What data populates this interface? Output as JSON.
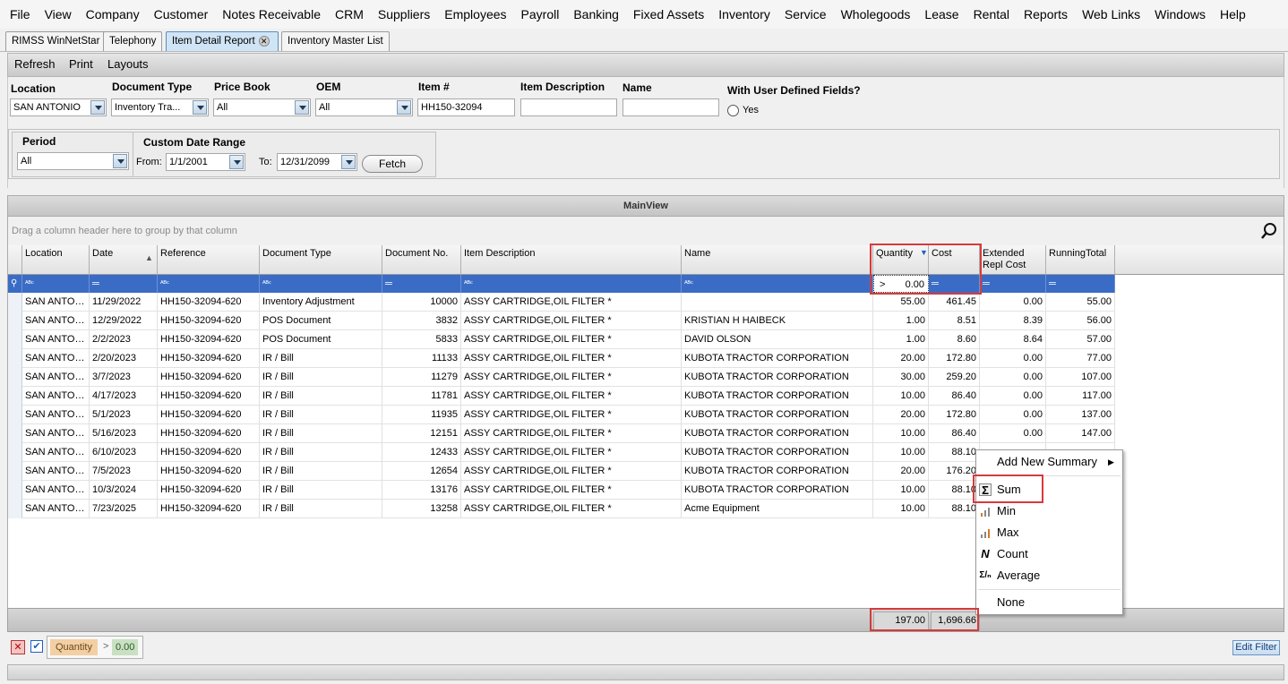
{
  "menu": [
    "File",
    "View",
    "Company",
    "Customer",
    "Notes Receivable",
    "CRM",
    "Suppliers",
    "Employees",
    "Payroll",
    "Banking",
    "Fixed Assets",
    "Inventory",
    "Service",
    "Wholegoods",
    "Lease",
    "Rental",
    "Reports",
    "Web Links",
    "Windows",
    "Help"
  ],
  "tabs": [
    "RIMSS WinNetStar",
    "Telephony",
    "Item Detail Report",
    "Inventory Master List"
  ],
  "toolbar": {
    "refresh": "Refresh",
    "print": "Print",
    "layouts": "Layouts"
  },
  "filters": {
    "location_label": "Location",
    "location_value": "SAN ANTONIO",
    "doctype_label": "Document Type",
    "doctype_value": "Inventory Tra...",
    "pricebook_label": "Price Book",
    "pricebook_value": "All",
    "oem_label": "OEM",
    "oem_value": "All",
    "item_label": "Item #",
    "item_value": "HH150-32094",
    "desc_label": "Item Description",
    "desc_value": "",
    "name_label": "Name",
    "name_value": "",
    "udf_label": "With User Defined Fields?",
    "udf_yes": "Yes"
  },
  "period": {
    "label": "Period",
    "value": "All"
  },
  "daterange": {
    "label": "Custom Date Range",
    "from_label": "From:",
    "from_value": "1/1/2001",
    "to_label": "To:",
    "to_value": "12/31/2099",
    "fetch": "Fetch"
  },
  "grid": {
    "title": "MainView",
    "group_hint": "Drag a column header here to group by that column",
    "columns": [
      "Location",
      "Date",
      "Reference",
      "Document Type",
      "Document No.",
      "Item Description",
      "Name",
      "Quantity",
      "Cost",
      "Extended Repl Cost",
      "RunningTotal"
    ],
    "filter_quantity": "0.00",
    "rows": [
      [
        "SAN ANTON...",
        "11/29/2022",
        "HH150-32094-620",
        "Inventory Adjustment",
        "10000",
        "ASSY CARTRIDGE,OIL FILTER   *",
        "",
        "55.00",
        "461.45",
        "0.00",
        "55.00"
      ],
      [
        "SAN ANTON...",
        "12/29/2022",
        "HH150-32094-620",
        "POS Document",
        "3832",
        "ASSY CARTRIDGE,OIL FILTER   *",
        "KRISTIAN H HAIBECK",
        "1.00",
        "8.51",
        "8.39",
        "56.00"
      ],
      [
        "SAN ANTON...",
        "2/2/2023",
        "HH150-32094-620",
        "POS Document",
        "5833",
        "ASSY CARTRIDGE,OIL FILTER   *",
        "DAVID OLSON",
        "1.00",
        "8.60",
        "8.64",
        "57.00"
      ],
      [
        "SAN ANTON...",
        "2/20/2023",
        "HH150-32094-620",
        "IR / Bill",
        "11133",
        "ASSY CARTRIDGE,OIL FILTER   *",
        "KUBOTA TRACTOR CORPORATION",
        "20.00",
        "172.80",
        "0.00",
        "77.00"
      ],
      [
        "SAN ANTON...",
        "3/7/2023",
        "HH150-32094-620",
        "IR / Bill",
        "11279",
        "ASSY CARTRIDGE,OIL FILTER   *",
        "KUBOTA TRACTOR CORPORATION",
        "30.00",
        "259.20",
        "0.00",
        "107.00"
      ],
      [
        "SAN ANTON...",
        "4/17/2023",
        "HH150-32094-620",
        "IR / Bill",
        "11781",
        "ASSY CARTRIDGE,OIL FILTER   *",
        "KUBOTA TRACTOR CORPORATION",
        "10.00",
        "86.40",
        "0.00",
        "117.00"
      ],
      [
        "SAN ANTON...",
        "5/1/2023",
        "HH150-32094-620",
        "IR / Bill",
        "11935",
        "ASSY CARTRIDGE,OIL FILTER   *",
        "KUBOTA TRACTOR CORPORATION",
        "20.00",
        "172.80",
        "0.00",
        "137.00"
      ],
      [
        "SAN ANTON...",
        "5/16/2023",
        "HH150-32094-620",
        "IR / Bill",
        "12151",
        "ASSY CARTRIDGE,OIL FILTER   *",
        "KUBOTA TRACTOR CORPORATION",
        "10.00",
        "86.40",
        "0.00",
        "147.00"
      ],
      [
        "SAN ANTON...",
        "6/10/2023",
        "HH150-32094-620",
        "IR / Bill",
        "12433",
        "ASSY CARTRIDGE,OIL FILTER   *",
        "KUBOTA TRACTOR CORPORATION",
        "10.00",
        "88.10",
        "",
        ""
      ],
      [
        "SAN ANTON...",
        "7/5/2023",
        "HH150-32094-620",
        "IR / Bill",
        "12654",
        "ASSY CARTRIDGE,OIL FILTER   *",
        "KUBOTA TRACTOR CORPORATION",
        "20.00",
        "176.20",
        "",
        ""
      ],
      [
        "SAN ANTON...",
        "10/3/2024",
        "HH150-32094-620",
        "IR / Bill",
        "13176",
        "ASSY CARTRIDGE,OIL FILTER   *",
        "KUBOTA TRACTOR CORPORATION",
        "10.00",
        "88.10",
        "",
        ""
      ],
      [
        "SAN ANTON...",
        "7/23/2025",
        "HH150-32094-620",
        "IR / Bill",
        "13258",
        "ASSY CARTRIDGE,OIL FILTER   *",
        "Acme Equipment",
        "10.00",
        "88.10",
        "",
        ""
      ]
    ],
    "sum_quantity": "197.00",
    "sum_cost": "1,696.66"
  },
  "filterbar": {
    "field": "Quantity",
    "op": ">",
    "value": "0.00",
    "edit": "Edit Filter"
  },
  "context_menu": {
    "add": "Add New Summary",
    "sum": "Sum",
    "min": "Min",
    "max": "Max",
    "count": "Count",
    "average": "Average",
    "none": "None"
  }
}
